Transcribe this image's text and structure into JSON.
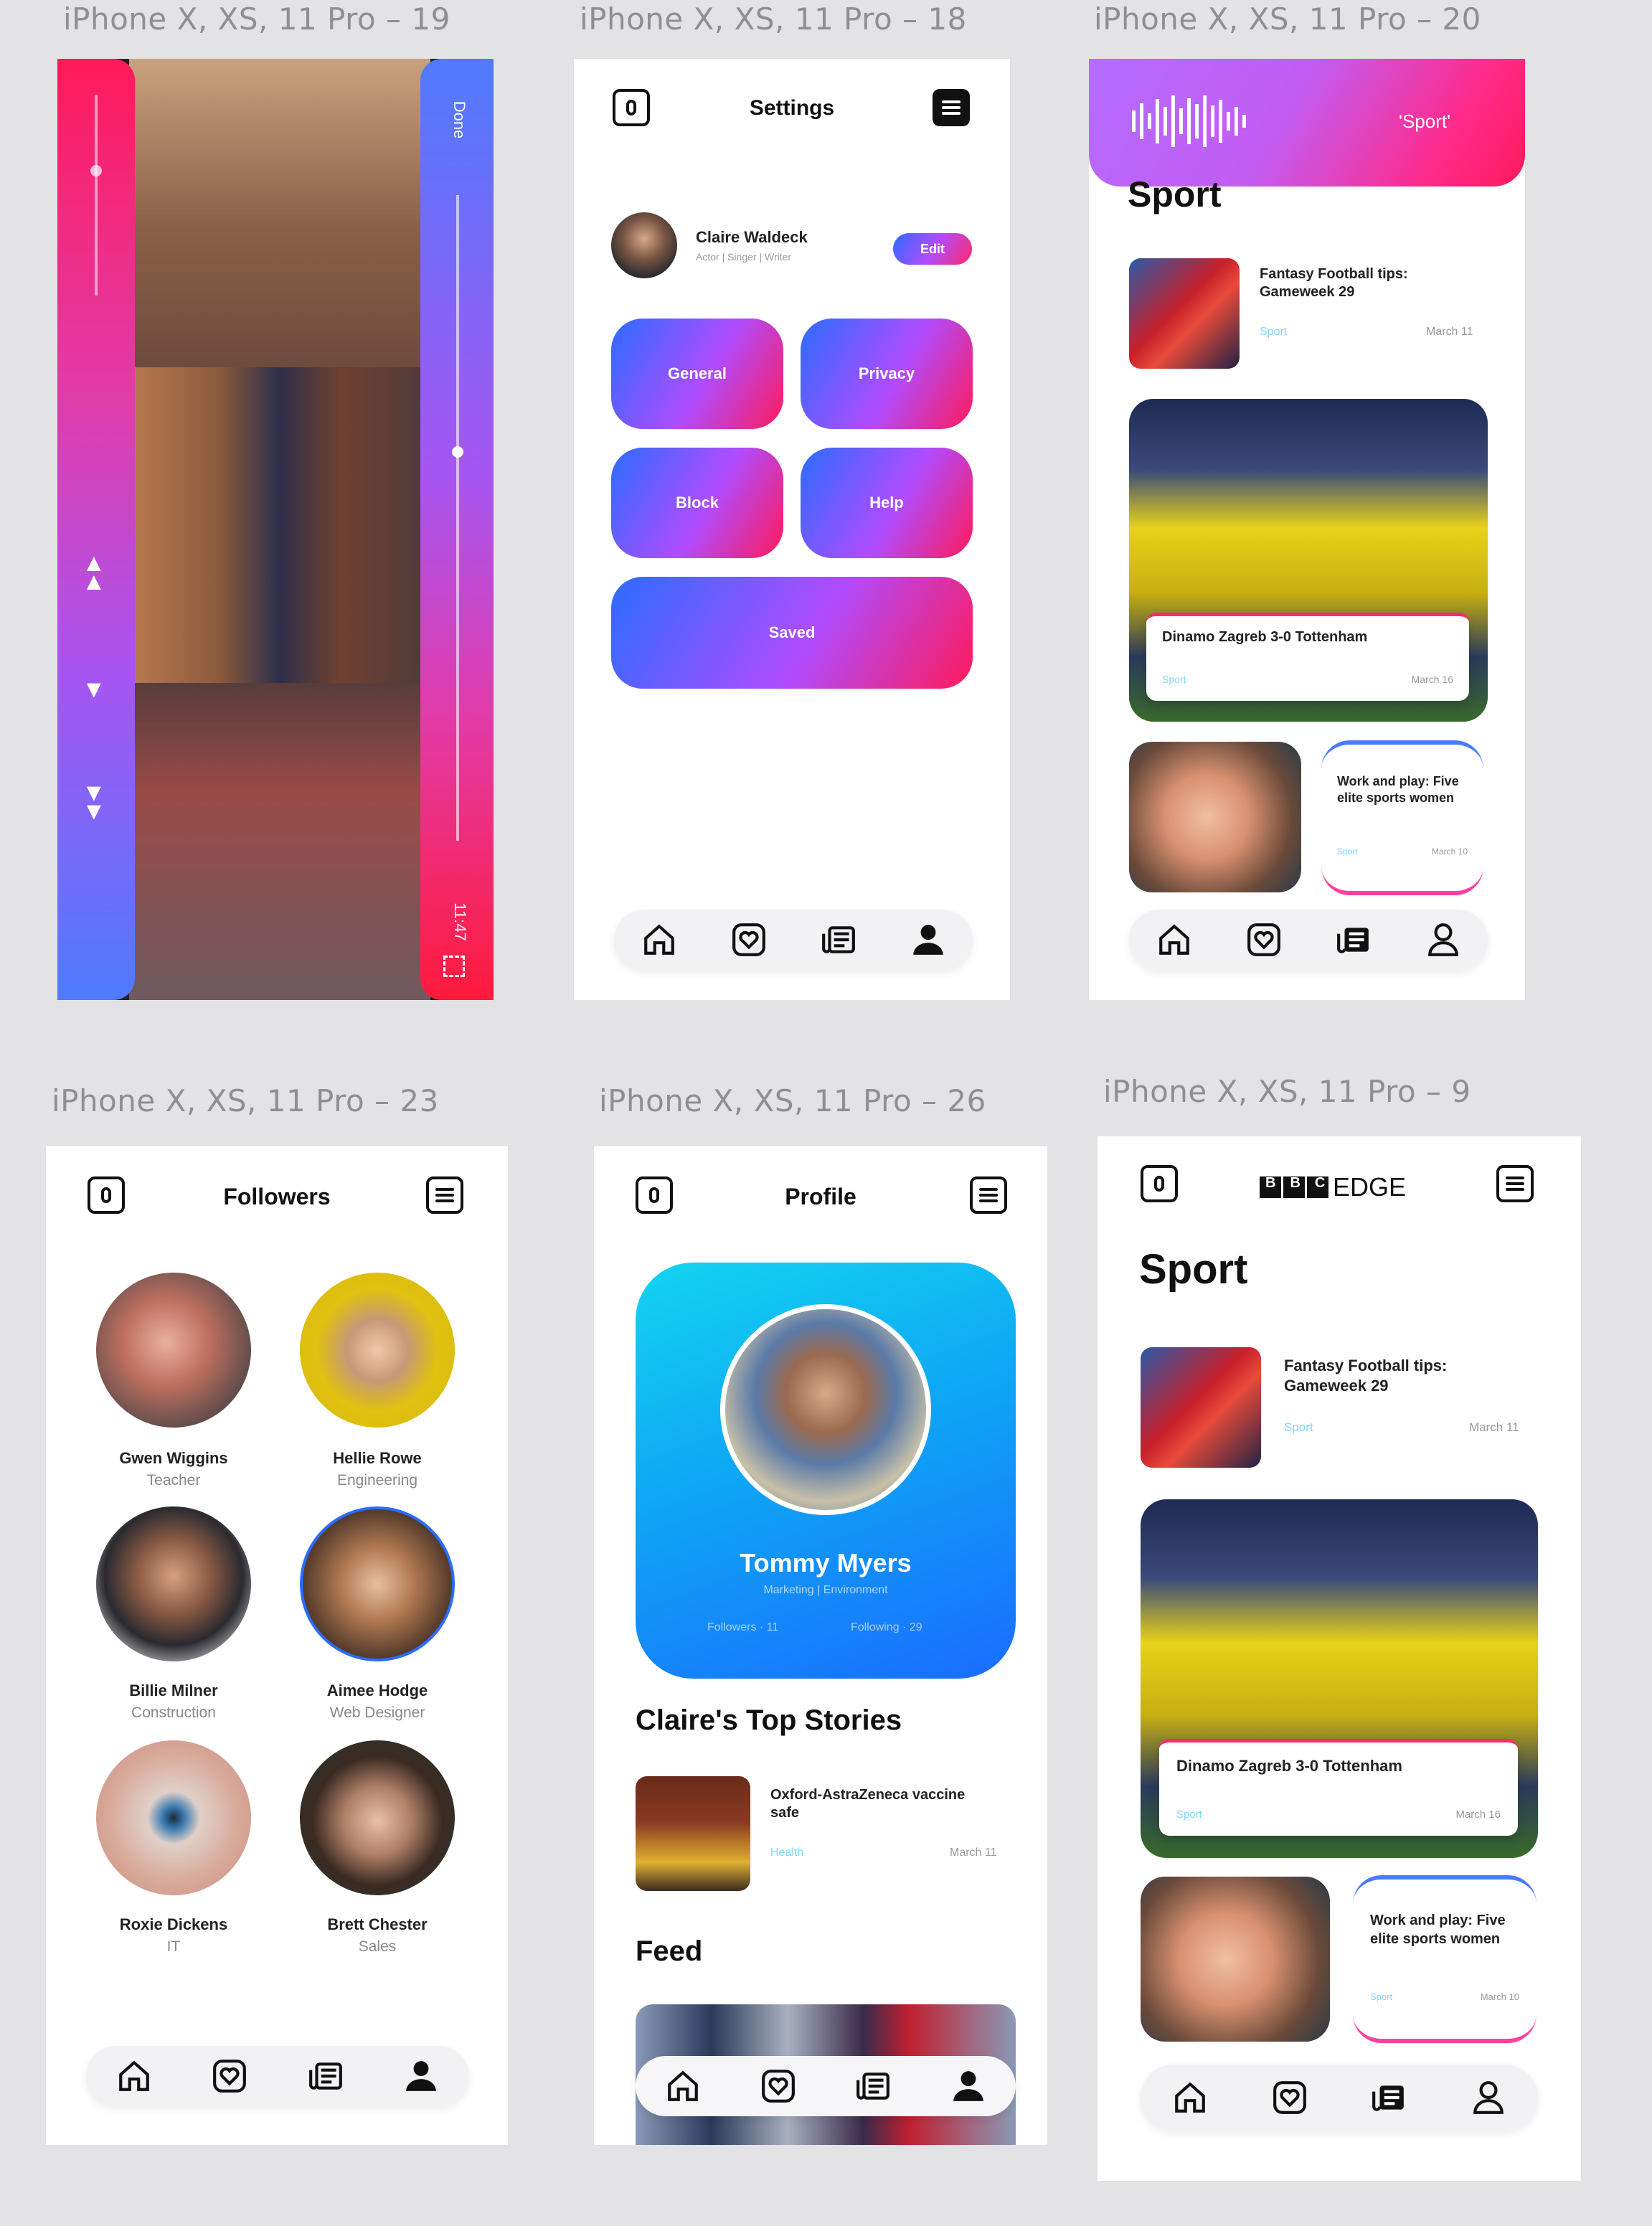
{
  "artboards": [
    {
      "label": "iPhone X, XS, 11 Pro – 19"
    },
    {
      "label": "iPhone X, XS, 11 Pro – 18"
    },
    {
      "label": "iPhone X, XS, 11 Pro – 20"
    },
    {
      "label": "iPhone X, XS, 11 Pro – 23"
    },
    {
      "label": "iPhone X, XS, 11 Pro – 26"
    },
    {
      "label": "iPhone X, XS, 11 Pro – 9"
    }
  ],
  "player": {
    "done_label": "Done",
    "time": "11:47"
  },
  "settings": {
    "title": "Settings",
    "user_name": "Claire Waldeck",
    "user_sub": "Actor | Singer | Writer",
    "edit_label": "Edit",
    "buttons": [
      "General",
      "Privacy",
      "Block",
      "Help"
    ],
    "saved_label": "Saved"
  },
  "sport_search": {
    "voice_query": "'Sport'",
    "title": "Sport"
  },
  "stories": {
    "fantasy": {
      "headline": "Fantasy Football tips: Gameweek 29",
      "category": "Sport",
      "date": "March 11"
    },
    "dinamo": {
      "headline": "Dinamo Zagreb 3-0 Tottenham",
      "category": "Sport",
      "date": "March 16"
    },
    "work_play": {
      "headline": "Work and play: Five elite sports women",
      "category": "Sport",
      "date": "March 10"
    }
  },
  "followers": {
    "title": "Followers",
    "people": [
      {
        "name": "Gwen Wiggins",
        "role": "Teacher"
      },
      {
        "name": "Hellie Rowe",
        "role": "Engineering"
      },
      {
        "name": "Billie Milner",
        "role": "Construction"
      },
      {
        "name": "Aimee Hodge",
        "role": "Web Designer"
      },
      {
        "name": "Roxie Dickens",
        "role": "IT"
      },
      {
        "name": "Brett Chester",
        "role": "Sales"
      }
    ]
  },
  "profile": {
    "title": "Profile",
    "name": "Tommy Myers",
    "sub": "Marketing | Environment",
    "followers_label": "Followers · 11",
    "following_label": "Following · 29",
    "top_stories_title": "Claire's Top Stories",
    "top_story": {
      "headline": "Oxford-AstraZeneca vaccine safe",
      "category": "Health",
      "date": "March 11"
    },
    "feed_title": "Feed"
  },
  "edge": {
    "logo_text": "BBC",
    "brand_suffix": "EDGE",
    "title": "Sport"
  },
  "colors": {
    "gradient_blue": "#2b6cff",
    "gradient_purple": "#b04cff",
    "gradient_pink": "#ff2a6a",
    "profile_cyan": "#14d4f0",
    "category_blue": "#7fd6ff"
  }
}
